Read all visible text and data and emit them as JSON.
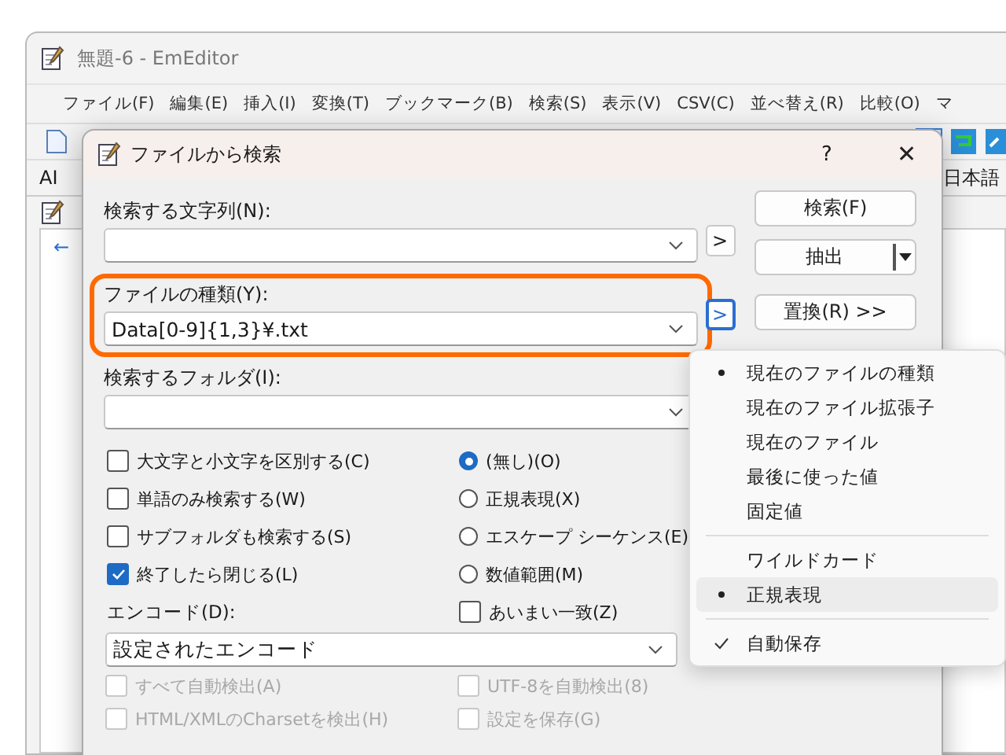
{
  "app_window": {
    "title": "無題-6 - EmEditor",
    "menu": [
      "ファイル(F)",
      "編集(E)",
      "挿入(I)",
      "変換(T)",
      "ブックマーク(B)",
      "検索(S)",
      "表示(V)",
      "CSV(C)",
      "並べ替え(R)",
      "比較(O)",
      "マ"
    ],
    "toolbar2": {
      "left": "AI",
      "right": "日本語"
    },
    "doc_arrow": "←"
  },
  "dialog": {
    "title": "ファイルから検索",
    "help": "?",
    "close": "✕",
    "fields": [
      {
        "label": "検索する文字列(N):",
        "arrow_button": ">",
        "highlighted": false,
        "focused": false
      },
      {
        "label": "ファイルの種類(Y):",
        "value": "Data[0-9]{1,3}¥.txt",
        "arrow_button": ">",
        "highlighted": true,
        "focused": true
      },
      {
        "label": "検索するフォルダ(I):",
        "highlighted": false
      }
    ],
    "buttons": [
      {
        "label": "検索(F)",
        "kind": "plain"
      },
      {
        "label": "抽出",
        "kind": "split"
      },
      {
        "label": "置換(R) >>",
        "kind": "plain"
      }
    ],
    "options": [
      {
        "label": "大文字と小文字を区別する(C)",
        "checked": false
      },
      {
        "label": "単語のみ検索する(W)",
        "checked": false
      },
      {
        "label": "サブフォルダも検索する(S)",
        "checked": false
      },
      {
        "label": "終了したら閉じる(L)",
        "checked": true
      }
    ],
    "modes": [
      {
        "label": "(無し)(O)",
        "selected": true
      },
      {
        "label": "正規表現(X)",
        "selected": false
      },
      {
        "label": "エスケープ シーケンス(E)",
        "selected": false
      },
      {
        "label": "数値範囲(M)",
        "selected": false
      }
    ],
    "fuzzy": {
      "label": "あいまい一致(Z)",
      "checked": false
    },
    "encoding": {
      "label": "エンコード(D):",
      "value": "設定されたエンコード"
    },
    "encoding_options": [
      {
        "label": "すべて自動検出(A)",
        "checked": false,
        "disabled": true
      },
      {
        "label": "UTF-8を自動検出(8)",
        "checked": false,
        "disabled": true
      },
      {
        "label": "HTML/XMLのCharsetを検出(H)",
        "checked": false,
        "disabled": true
      },
      {
        "label": "設定を保存(G)",
        "checked": false,
        "disabled": true
      }
    ]
  },
  "popup_menu": {
    "sections": [
      [
        {
          "label": "現在のファイルの種類",
          "bullet": true,
          "checked": false,
          "highlighted": false
        },
        {
          "label": "現在のファイル拡張子",
          "bullet": false,
          "checked": false,
          "highlighted": false
        },
        {
          "label": "現在のファイル",
          "bullet": false,
          "checked": false,
          "highlighted": false
        },
        {
          "label": "最後に使った値",
          "bullet": false,
          "checked": false,
          "highlighted": false
        },
        {
          "label": "固定値",
          "bullet": false,
          "checked": false,
          "highlighted": false
        }
      ],
      [
        {
          "label": "ワイルドカード",
          "bullet": false,
          "checked": false,
          "highlighted": false
        },
        {
          "label": "正規表現",
          "bullet": true,
          "checked": false,
          "highlighted": true
        }
      ],
      [
        {
          "label": "自動保存",
          "bullet": false,
          "checked": true,
          "highlighted": false
        }
      ]
    ]
  }
}
